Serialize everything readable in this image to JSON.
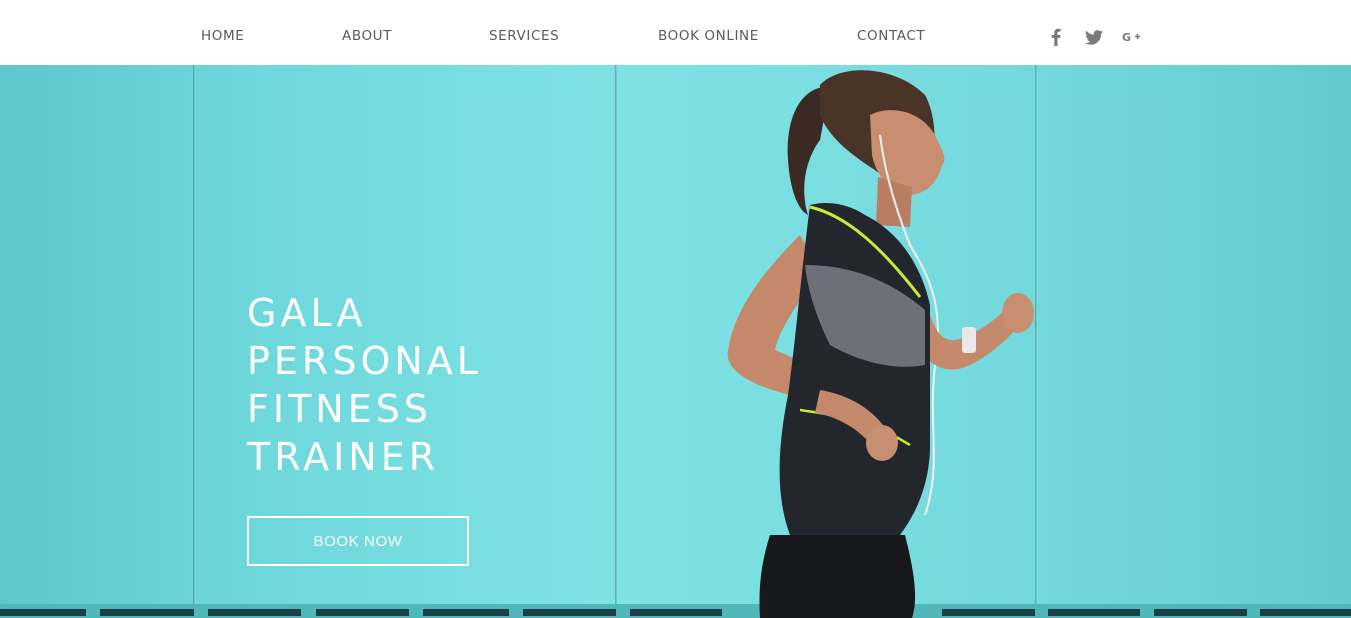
{
  "nav": {
    "items": [
      {
        "label": "HOME"
      },
      {
        "label": "ABOUT"
      },
      {
        "label": "SERVICES"
      },
      {
        "label": "BOOK ONLINE"
      },
      {
        "label": "CONTACT"
      }
    ],
    "social": [
      {
        "icon": "facebook-icon"
      },
      {
        "icon": "twitter-icon"
      },
      {
        "icon": "google-plus-icon"
      }
    ]
  },
  "hero": {
    "title_lines": [
      "GALA",
      "PERSONAL",
      "FITNESS",
      "TRAINER"
    ],
    "button_label": "BOOK NOW",
    "background_color": "#7ee2e5"
  }
}
